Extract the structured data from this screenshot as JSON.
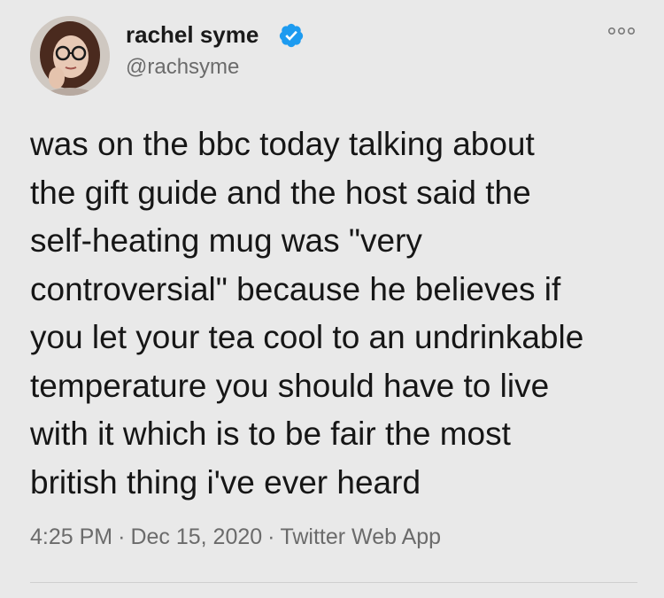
{
  "user": {
    "display_name": "rachel syme",
    "handle": "@rachsyme",
    "verified": true
  },
  "tweet": {
    "lines": [
      "was on the bbc today talking about",
      "the gift guide and the host said the",
      "self-heating mug was \"very",
      "controversial\" because he believes if",
      "you let your tea cool to an undrinkable",
      "temperature you should have to live",
      "with it which is to be fair the most",
      "british thing i've ever heard"
    ],
    "time": "4:25 PM",
    "date": "Dec 15, 2020",
    "source": "Twitter Web App",
    "separator": "·"
  },
  "colors": {
    "background": "#e9e9e9",
    "verified_badge": "#1d9bf0",
    "muted_text": "#6b6b6b"
  },
  "icons": {
    "verified": "verified-badge-icon",
    "more": "more-options-icon"
  }
}
